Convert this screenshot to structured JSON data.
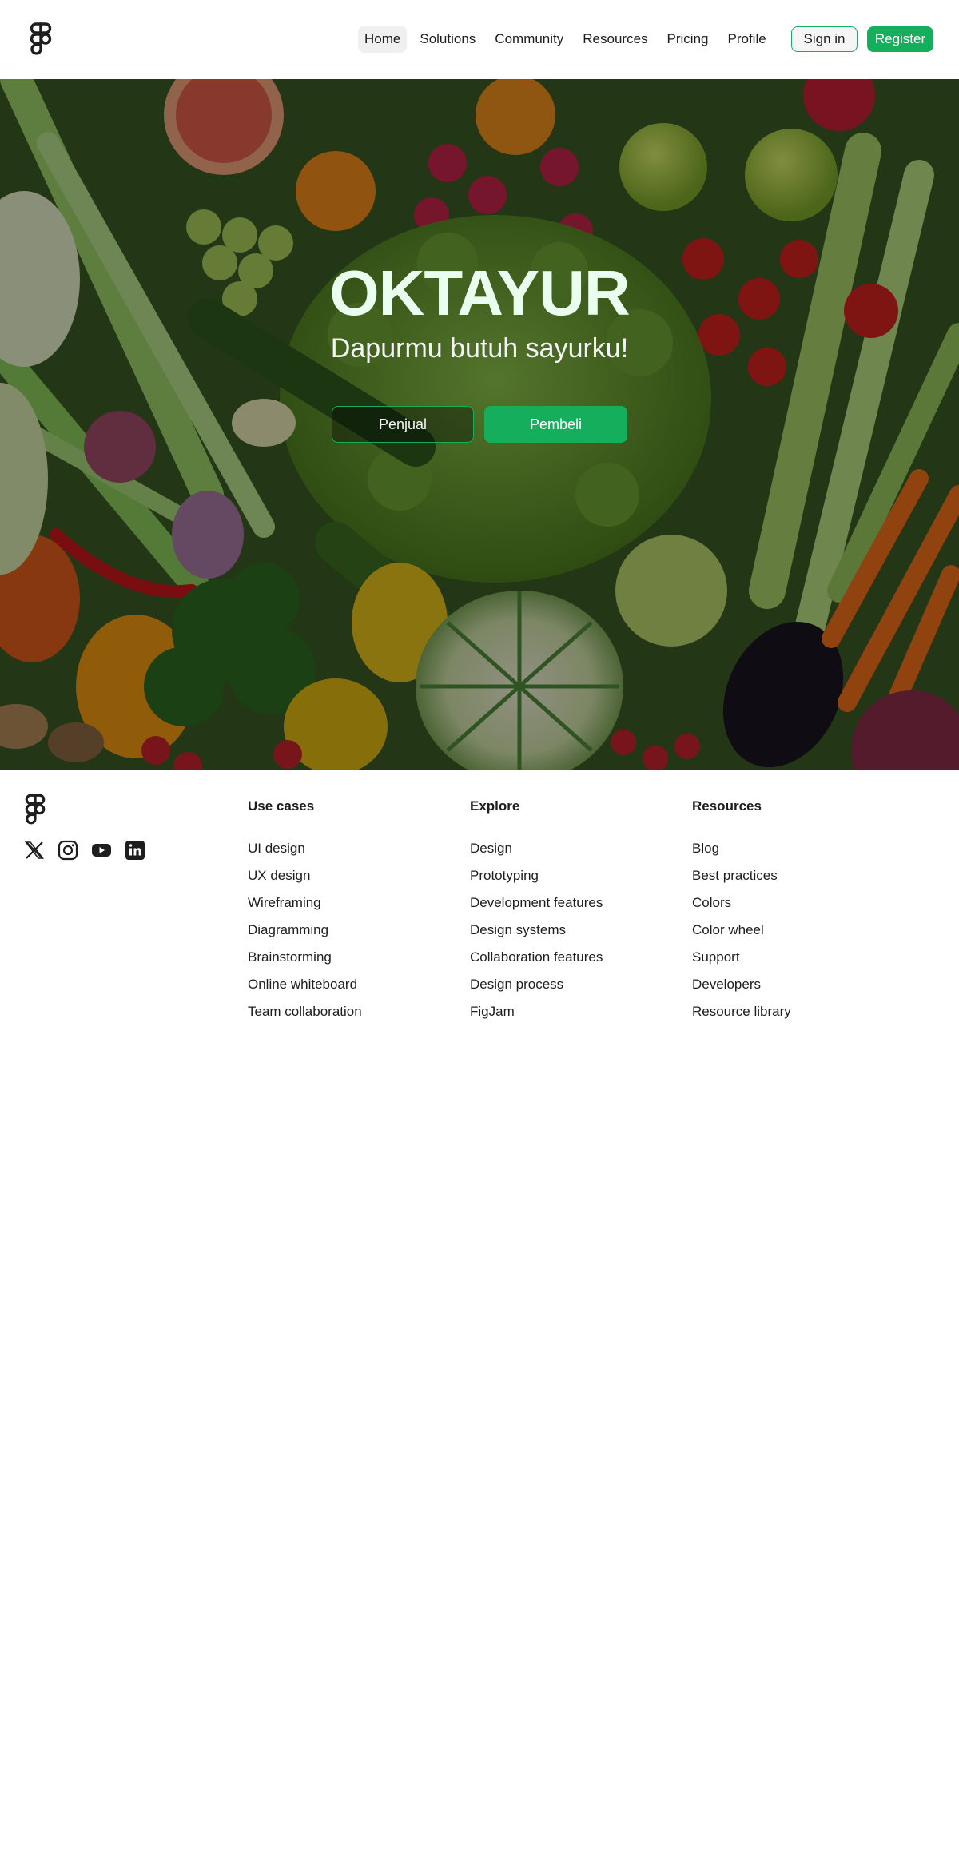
{
  "header": {
    "nav": [
      {
        "label": "Home",
        "active": true
      },
      {
        "label": "Solutions",
        "active": false
      },
      {
        "label": "Community",
        "active": false
      },
      {
        "label": "Resources",
        "active": false
      },
      {
        "label": "Pricing",
        "active": false
      },
      {
        "label": "Profile",
        "active": false
      }
    ],
    "sign_in_label": "Sign in",
    "register_label": "Register"
  },
  "hero": {
    "title": "OKTAYUR",
    "subtitle": "Dapurmu butuh sayurku!",
    "seller_button": "Penjual",
    "buyer_button": "Pembeli"
  },
  "footer": {
    "socials": [
      "x-icon",
      "instagram-icon",
      "youtube-icon",
      "linkedin-icon"
    ],
    "columns": [
      {
        "heading": "Use cases",
        "links": [
          "UI design",
          "UX design",
          "Wireframing",
          "Diagramming",
          "Brainstorming",
          "Online whiteboard",
          "Team collaboration"
        ]
      },
      {
        "heading": "Explore",
        "links": [
          "Design",
          "Prototyping",
          "Development features",
          "Design systems",
          "Collaboration features",
          "Design process",
          "FigJam"
        ]
      },
      {
        "heading": "Resources",
        "links": [
          "Blog",
          "Best practices",
          "Colors",
          "Color wheel",
          "Support",
          "Developers",
          "Resource library"
        ]
      }
    ]
  },
  "colors": {
    "accent": "#14ae5c",
    "hero_title": "#ebffee",
    "text": "#1e1e1e"
  }
}
